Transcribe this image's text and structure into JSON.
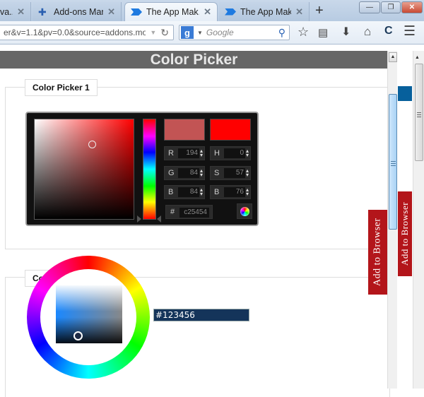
{
  "browser": {
    "tabs": [
      {
        "label": "va...",
        "icon": "page-icon",
        "active": false
      },
      {
        "label": "Add-ons Man...",
        "icon": "puzzle-icon",
        "active": false
      },
      {
        "label": "The App Mak...",
        "icon": "app-maker-icon",
        "active": true
      },
      {
        "label": "The App Mak...",
        "icon": "app-maker-icon",
        "active": false
      }
    ],
    "new_tab_label": "+",
    "window_controls": {
      "minimize": "—",
      "restore": "❐",
      "close": "✕"
    },
    "url": "er&v=1.1&pv=0.0&source=addons.mozill",
    "search_placeholder": "Google",
    "toolbar_icons": [
      "star-icon",
      "clipboard-icon",
      "download-icon",
      "home-icon",
      "c-icon",
      "menu-icon"
    ]
  },
  "page": {
    "title": "Color Picker",
    "picker1": {
      "legend": "Color Picker 1",
      "new_color": "#c25454",
      "current_color": "#ff0000",
      "fields": {
        "R": {
          "label": "R",
          "value": "194"
        },
        "G": {
          "label": "G",
          "value": "84"
        },
        "B": {
          "label": "B",
          "value": "84"
        },
        "H": {
          "label": "H",
          "value": "0"
        },
        "S": {
          "label": "S",
          "value": "57"
        },
        "Bri": {
          "label": "B",
          "value": "76"
        }
      },
      "hex_label": "#",
      "hex_value": "c25454"
    },
    "picker2": {
      "legend": "Color Picker 2",
      "hex_value": "#123456"
    },
    "add_to_browser_label": "Add to Browser"
  }
}
